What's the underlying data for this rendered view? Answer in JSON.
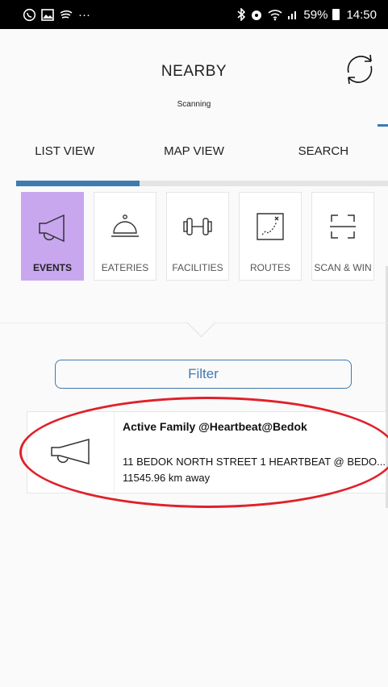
{
  "status_bar": {
    "left_icons": [
      "whatsapp-icon",
      "gallery-icon",
      "spotify-icon",
      "more-icon"
    ],
    "more": "···",
    "right_icons": [
      "bluetooth-icon",
      "alarm-icon",
      "wifi-icon",
      "signal-icon",
      "battery-icon"
    ],
    "battery": "59%",
    "time": "14:50"
  },
  "header": {
    "title": "NEARBY",
    "subtitle": "Scanning",
    "refresh_icon": "refresh-icon"
  },
  "tabs": [
    {
      "label": "LIST VIEW",
      "active": true
    },
    {
      "label": "MAP VIEW",
      "active": false
    },
    {
      "label": "SEARCH",
      "active": false
    }
  ],
  "categories": [
    {
      "label": "EVENTS",
      "icon": "megaphone-icon",
      "active": true
    },
    {
      "label": "EATERIES",
      "icon": "cloche-icon",
      "active": false
    },
    {
      "label": "FACILITIES",
      "icon": "dumbbell-icon",
      "active": false
    },
    {
      "label": "ROUTES",
      "icon": "map-icon",
      "active": false
    },
    {
      "label": "SCAN & WIN",
      "icon": "scan-icon",
      "active": false
    }
  ],
  "filter": {
    "label": "Filter"
  },
  "results": [
    {
      "title": "Active Family @Heartbeat@Bedok",
      "address": "11 BEDOK NORTH STREET 1 HEARTBEAT @ BEDO...",
      "distance": "11545.96 km away",
      "icon": "megaphone-icon"
    }
  ],
  "colors": {
    "accent": "#3d7bb0",
    "active_category": "#c8a7ef",
    "highlight_circle": "#e0202a",
    "status_bar": "#000000"
  }
}
